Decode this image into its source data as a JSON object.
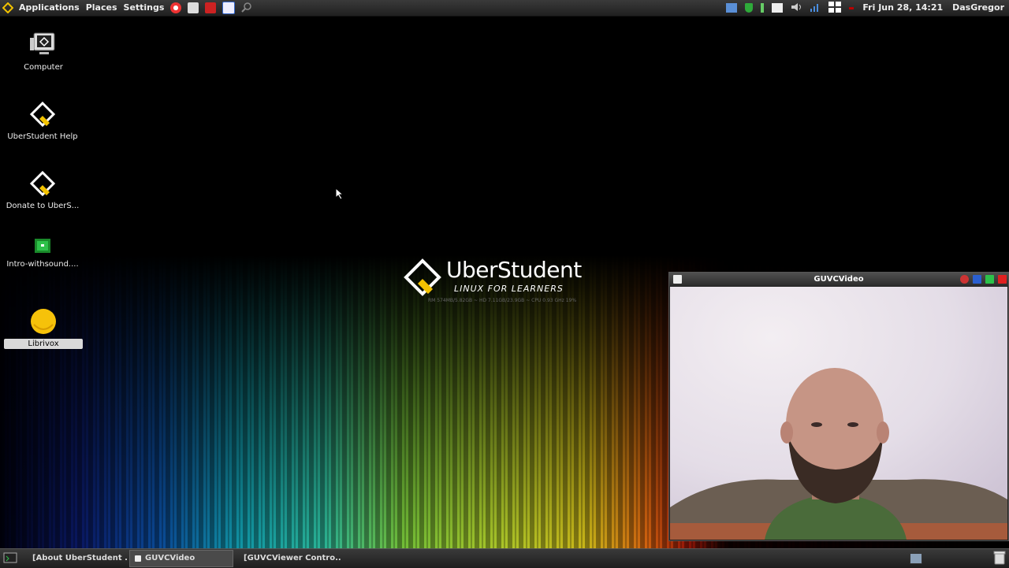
{
  "top_panel": {
    "menus": [
      "Applications",
      "Places",
      "Settings"
    ],
    "clock": "Fri Jun 28, 14:21",
    "user": "DasGregor"
  },
  "desktop_icons": [
    {
      "label": "Computer",
      "icon": "computer-icon"
    },
    {
      "label": "UberStudent Help",
      "icon": "uberstudent-help-icon"
    },
    {
      "label": "Donate to UberS...",
      "icon": "uberstudent-donate-icon"
    },
    {
      "label": "Intro-withsound....",
      "icon": "video-file-icon"
    },
    {
      "label": "Librivox",
      "icon": "librivox-icon"
    }
  ],
  "logo": {
    "title": "UberStudent",
    "tagline": "LINUX FOR LEARNERS",
    "sysinfo": "RM 574MB/5.82GB ~ HD 7.11GB/23.9GB ~ CPU 0.93 GHz 19%"
  },
  "video_window": {
    "title": "GUVCVideo"
  },
  "taskbar": {
    "tasks": [
      "[About UberStudent ...",
      "GUVCVideo",
      "[GUVCViewer Contro..."
    ]
  },
  "colors": {
    "panel": "#2a2a2a",
    "accent_yellow": "#f2c200",
    "active_task": "#4a4a4a"
  }
}
